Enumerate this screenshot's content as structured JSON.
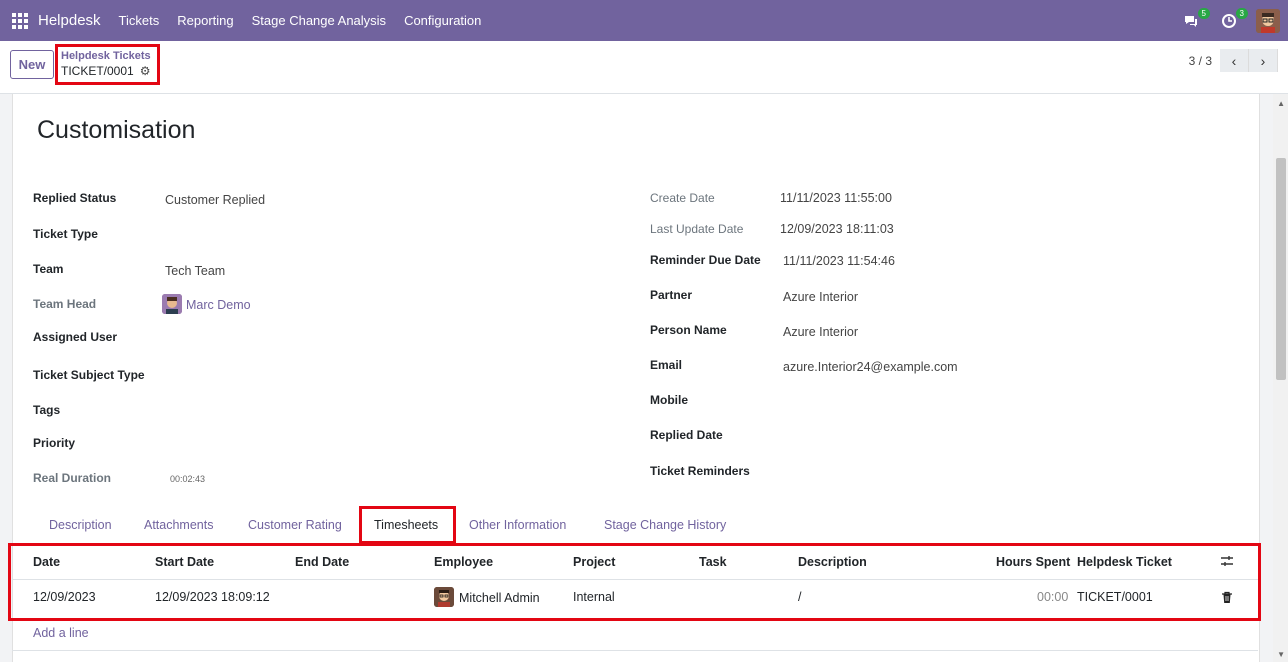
{
  "navbar": {
    "brand": "Helpdesk",
    "menu": [
      "Tickets",
      "Reporting",
      "Stage Change Analysis",
      "Configuration"
    ],
    "messages_count": "5",
    "activities_count": "3"
  },
  "control": {
    "new_label": "New",
    "breadcrumb_parent": "Helpdesk Tickets",
    "breadcrumb_current": "TICKET/0001",
    "pager_value": "3 / 3"
  },
  "form": {
    "title": "Customisation",
    "left_fields": [
      {
        "label": "Replied Status",
        "value": "Customer Replied"
      },
      {
        "label": "Ticket Type",
        "value": ""
      },
      {
        "label": "Team",
        "value": "Tech Team"
      },
      {
        "label": "Team Head",
        "value": "Marc Demo"
      },
      {
        "label": "Assigned User",
        "value": ""
      },
      {
        "label": "Ticket Subject Type",
        "value": ""
      },
      {
        "label": "Tags",
        "value": ""
      },
      {
        "label": "Priority",
        "value": ""
      },
      {
        "label": "Real Duration",
        "value": "00:02:43"
      }
    ],
    "right_fields": [
      {
        "label": "Create Date",
        "value": "11/11/2023 11:55:00"
      },
      {
        "label": "Last Update Date",
        "value": "12/09/2023 18:11:03"
      },
      {
        "label": "Reminder Due Date",
        "value": "11/11/2023 11:54:46"
      },
      {
        "label": "Partner",
        "value": "Azure Interior"
      },
      {
        "label": "Person Name",
        "value": "Azure Interior"
      },
      {
        "label": "Email",
        "value": "azure.Interior24@example.com"
      },
      {
        "label": "Mobile",
        "value": ""
      },
      {
        "label": "Replied Date",
        "value": ""
      },
      {
        "label": "Ticket Reminders",
        "value": ""
      }
    ]
  },
  "tabs": [
    "Description",
    "Attachments",
    "Customer Rating",
    "Timesheets",
    "Other Information",
    "Stage Change History"
  ],
  "timesheet": {
    "columns": [
      "Date",
      "Start Date",
      "End Date",
      "Employee",
      "Project",
      "Task",
      "Description",
      "Hours Spent",
      "Helpdesk Ticket"
    ],
    "row": {
      "date": "12/09/2023",
      "start_date": "12/09/2023 18:09:12",
      "end_date": "",
      "employee": "Mitchell Admin",
      "project": "Internal",
      "task": "",
      "description": "/",
      "hours_spent": "00:00",
      "helpdesk_ticket": "TICKET/0001"
    },
    "add_line": "Add a line"
  }
}
